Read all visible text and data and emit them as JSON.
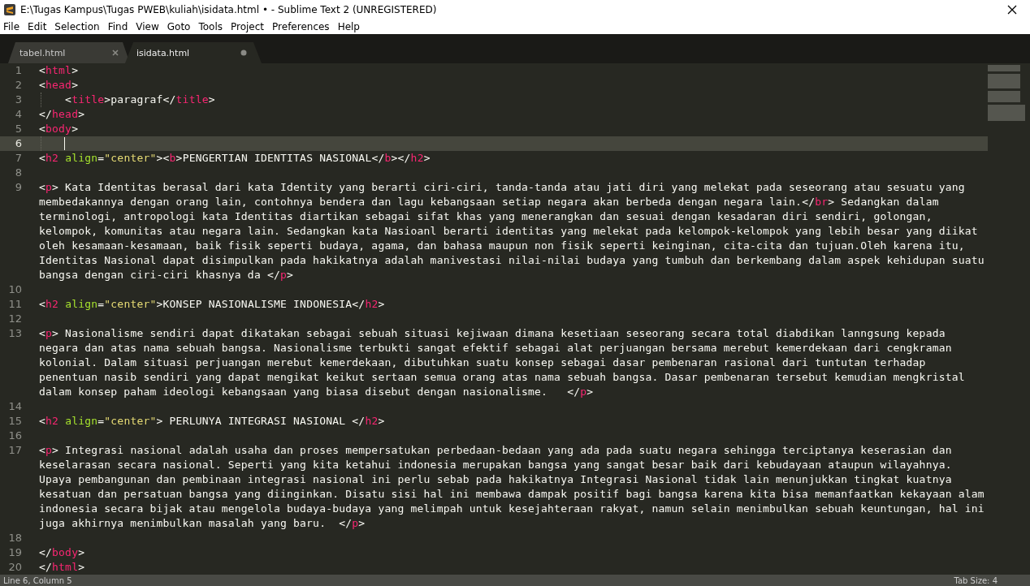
{
  "window": {
    "title": "E:\\Tugas Kampus\\Tugas PWEB\\kuliah\\isidata.html • - Sublime Text 2 (UNREGISTERED)"
  },
  "menu": [
    "File",
    "Edit",
    "Selection",
    "Find",
    "View",
    "Goto",
    "Tools",
    "Project",
    "Preferences",
    "Help"
  ],
  "tabs": [
    {
      "label": "tabel.html",
      "selected": false,
      "modified": false
    },
    {
      "label": "isidata.html",
      "selected": true,
      "modified": true
    }
  ],
  "editor": {
    "lines": [
      {
        "number": "1",
        "current": false,
        "rows": [
          "<html>"
        ]
      },
      {
        "number": "2",
        "current": false,
        "rows": [
          "<head>"
        ]
      },
      {
        "number": "3",
        "current": false,
        "indent_guide": true,
        "rows": [
          "    <title>paragraf</title>"
        ]
      },
      {
        "number": "4",
        "current": false,
        "rows": [
          "</head>"
        ]
      },
      {
        "number": "5",
        "current": false,
        "rows": [
          "<body>"
        ]
      },
      {
        "number": "6",
        "current": true,
        "indent_guide": true
      },
      {
        "number": "7",
        "current": false,
        "rows": [
          "<h2 align=\"center\"><b>PENGERTIAN IDENTITAS NASIONAL</b></h2>"
        ]
      },
      {
        "number": "8",
        "current": false
      },
      {
        "number": "9",
        "current": false,
        "rows": [
          "<p> Kata Identitas berasal dari kata Identity yang berarti ciri-ciri, tanda-tanda atau jati diri yang melekat pada seseorang atau sesuatu yang",
          "membedakannya dengan orang lain, contohnya bendera dan lagu kebangsaan setiap negara akan berbeda dengan negara lain.</br> Sedangkan dalam",
          "terminologi, antropologi kata Identitas diartikan sebagai sifat khas yang menerangkan dan sesuai dengan kesadaran diri sendiri, golongan,",
          "kelompok, komunitas atau negara lain. Sedangkan kata Nasioanl berarti identitas yang melekat pada kelompok-kelompok yang lebih besar yang diikat",
          "oleh kesamaan-kesamaan, baik fisik seperti budaya, agama, dan bahasa maupun non fisik seperti keinginan, cita-cita dan tujuan.Oleh karena itu,",
          "Identitas Nasional dapat disimpulkan pada hakikatnya adalah manivestasi nilai-nilai budaya yang tumbuh dan berkembang dalam aspek kehidupan suatu",
          "bangsa dengan ciri-ciri khasnya da </p>"
        ]
      },
      {
        "number": "10",
        "current": false
      },
      {
        "number": "11",
        "current": false,
        "rows": [
          "<h2 align=\"center\">KONSEP NASIONALISME INDONESIA</h2>"
        ]
      },
      {
        "number": "12",
        "current": false
      },
      {
        "number": "13",
        "current": false,
        "rows": [
          "<p> Nasionalisme sendiri dapat dikatakan sebagai sebuah situasi kejiwaan dimana kesetiaan seseorang secara total diabdikan lanngsung kepada",
          "negara dan atas nama sebuah bangsa. Nasionalisme terbukti sangat efektif sebagai alat perjuangan bersama merebut kemerdekaan dari cengkraman",
          "kolonial. Dalam situasi perjuangan merebut kemerdekaan, dibutuhkan suatu konsep sebagai dasar pembenaran rasional dari tuntutan terhadap",
          "penentuan nasib sendiri yang dapat mengikat keikut sertaan semua orang atas nama sebuah bangsa. Dasar pembenaran tersebut kemudian mengkristal",
          "dalam konsep paham ideologi kebangsaan yang biasa disebut dengan nasionalisme.   </p>"
        ]
      },
      {
        "number": "14",
        "current": false
      },
      {
        "number": "15",
        "current": false,
        "rows": [
          "<h2 align=\"center\"> PERLUNYA INTEGRASI NASIONAL </h2>"
        ]
      },
      {
        "number": "16",
        "current": false
      },
      {
        "number": "17",
        "current": false,
        "rows": [
          "<p> Integrasi nasional adalah usaha dan proses mempersatukan perbedaan-bedaan yang ada pada suatu negara sehingga terciptanya keserasian dan",
          "keselarasan secara nasional. Seperti yang kita ketahui indonesia merupakan bangsa yang sangat besar baik dari kebudayaan ataupun wilayahnya.",
          "Upaya pembangunan dan pembinaan integrasi nasional ini perlu sebab pada hakikatnya Integrasi Nasional tidak lain menunjukkan tingkat kuatnya",
          "kesatuan dan persatuan bangsa yang diinginkan. Disatu sisi hal ini membawa dampak positif bagi bangsa karena kita bisa memanfaatkan kekayaan alam",
          "indonesia secara bijak atau mengelola budaya-budaya yang melimpah untuk kesejahteraan rakyat, namun selain menimbulkan sebuah keuntungan, hal ini",
          "juga akhirnya menimbulkan masalah yang baru.  </p>"
        ]
      },
      {
        "number": "18",
        "current": false
      },
      {
        "number": "19",
        "current": false,
        "rows": [
          "</body>"
        ]
      },
      {
        "number": "20",
        "current": false,
        "rows": [
          "</html>"
        ]
      }
    ]
  },
  "status_bar": {
    "position": "Line 6, Column 5",
    "tab_size": "Tab Size: 4"
  }
}
